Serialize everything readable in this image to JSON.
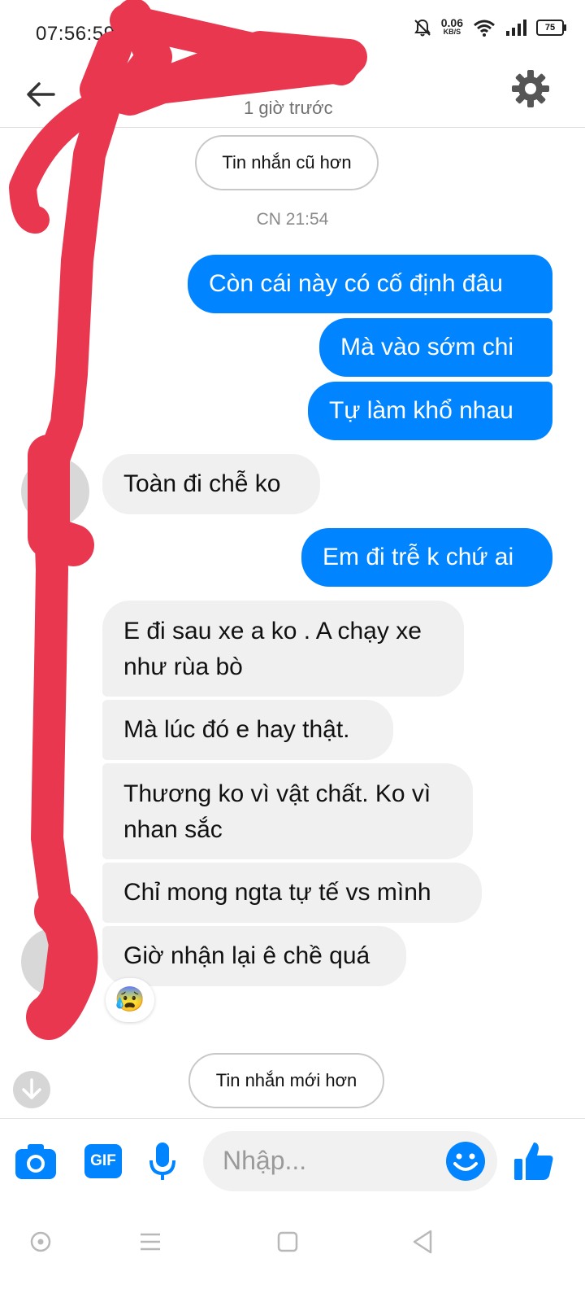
{
  "status_bar": {
    "time": "07:56:59",
    "net_speed_value": "0.06",
    "net_speed_unit": "KB/S",
    "battery": "75"
  },
  "header": {
    "subtitle": "1 giờ trước",
    "back_icon": "arrow-left-icon",
    "settings_icon": "gear-icon"
  },
  "conversation": {
    "older_button": "Tin nhắn cũ hơn",
    "timestamp": "CN 21:54",
    "newer_button": "Tin nhắn mới hơn",
    "messages": [
      {
        "side": "out",
        "text": "Còn cái này có cố định đâu"
      },
      {
        "side": "out",
        "text": "Mà vào sớm chi"
      },
      {
        "side": "out",
        "text": "Tự làm khổ nhau"
      },
      {
        "side": "in",
        "text": "Toàn đi chễ ko"
      },
      {
        "side": "out",
        "text": "Em đi trễ k chứ ai"
      },
      {
        "side": "in",
        "text": "E đi sau xe a ko . A chạy xe như rùa bò"
      },
      {
        "side": "in",
        "text": "Mà lúc đó e hay thật."
      },
      {
        "side": "in",
        "text": "Thương ko vì vật chất. Ko vì nhan sắc"
      },
      {
        "side": "in",
        "text": "Chỉ mong ngta tự tế vs mình"
      },
      {
        "side": "in",
        "text": "Giờ nhận lại ê chề quá"
      }
    ],
    "reaction": "😰"
  },
  "composer": {
    "placeholder": "Nhập...",
    "gif_label": "GIF",
    "icons": [
      "camera-icon",
      "gif-icon",
      "microphone-icon",
      "emoji-icon",
      "thumbs-up-icon"
    ]
  },
  "colors": {
    "accent": "#0084ff",
    "incoming_bubble": "#f0f0f0",
    "scribble": "#e8374f"
  }
}
